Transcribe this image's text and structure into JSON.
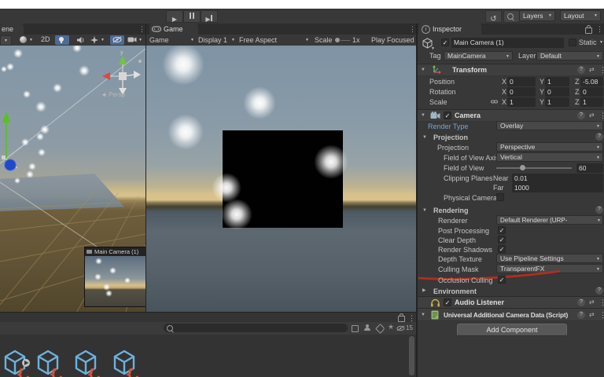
{
  "icons": {
    "caret": "▼",
    "check": "✓",
    "kebab": "⋮",
    "help": "?",
    "preset": "⇄",
    "foldout_open": "▼",
    "foldout_closed": "▶",
    "play": "▶",
    "step": "▶",
    "undo": "↺",
    "star": "★",
    "info": "i"
  },
  "colors": {
    "annotation_red": "#bf2b1e",
    "active_toggle_blue": "#4d6b94",
    "override_label_blue": "#7ba3d0",
    "panel_bg": "#383838",
    "field_bg": "#2a2a2a"
  },
  "top_bar": {
    "layers": "Layers",
    "layout": "Layout"
  },
  "tabs": {
    "scene": "ene",
    "game": "Game",
    "inspector": "Inspector"
  },
  "scene": {
    "mode_2d": "2D",
    "persp_label": "◄ Persp",
    "axis_y_label": "y",
    "camera_preview_title": "Main Camera (1)"
  },
  "game_toolbar": {
    "game": "Game",
    "display": "Display 1",
    "aspect": "Free Aspect",
    "scale_label": "Scale",
    "scale_value": "1x",
    "play_focused": "Play Focused"
  },
  "inspector": {
    "header": {
      "name": "Main Camera (1)",
      "static_label": "Static",
      "tag_label": "Tag",
      "tag_value": "MainCamera",
      "layer_label": "Layer",
      "layer_value": "Default"
    },
    "transform": {
      "title": "Transform",
      "axes": {
        "x": "X",
        "y": "Y",
        "z": "Z"
      },
      "rows": [
        {
          "label": "Position",
          "x": "0",
          "y": "1",
          "z": "-5.08"
        },
        {
          "label": "Rotation",
          "x": "0",
          "y": "0",
          "z": "0"
        },
        {
          "label": "Scale",
          "x": "1",
          "y": "1",
          "z": "1"
        }
      ]
    },
    "camera": {
      "title": "Camera",
      "render_type_label": "Render Type",
      "render_type_value": "Overlay",
      "projection_section": "Projection",
      "projection_label": "Projection",
      "projection_value": "Perspective",
      "fov_axis_label": "Field of View Axis",
      "fov_axis_value": "Vertical",
      "fov_label": "Field of View",
      "fov_value": "60",
      "clipping_label": "Clipping Planes",
      "near_label": "Near",
      "near_value": "0.01",
      "far_label": "Far",
      "far_value": "1000",
      "physical_label": "Physical Camera",
      "rendering_section": "Rendering",
      "renderer_label": "Renderer",
      "renderer_value": "Default Renderer (URP-HighFidelit",
      "post_processing_label": "Post Processing",
      "clear_depth_label": "Clear Depth",
      "render_shadows_label": "Render Shadows",
      "depth_texture_label": "Depth Texture",
      "depth_texture_value": "Use Pipeline Settings",
      "culling_mask_label": "Culling Mask",
      "culling_mask_value": "TransparentFX",
      "occlusion_label": "Occlusion Culling",
      "environment_section": "Environment"
    },
    "audio_listener": {
      "title": "Audio Listener"
    },
    "uacd": {
      "title": "Universal Additional Camera Data (Script)"
    },
    "add_component": "Add Component"
  },
  "project": {
    "hidden_count": "15"
  }
}
